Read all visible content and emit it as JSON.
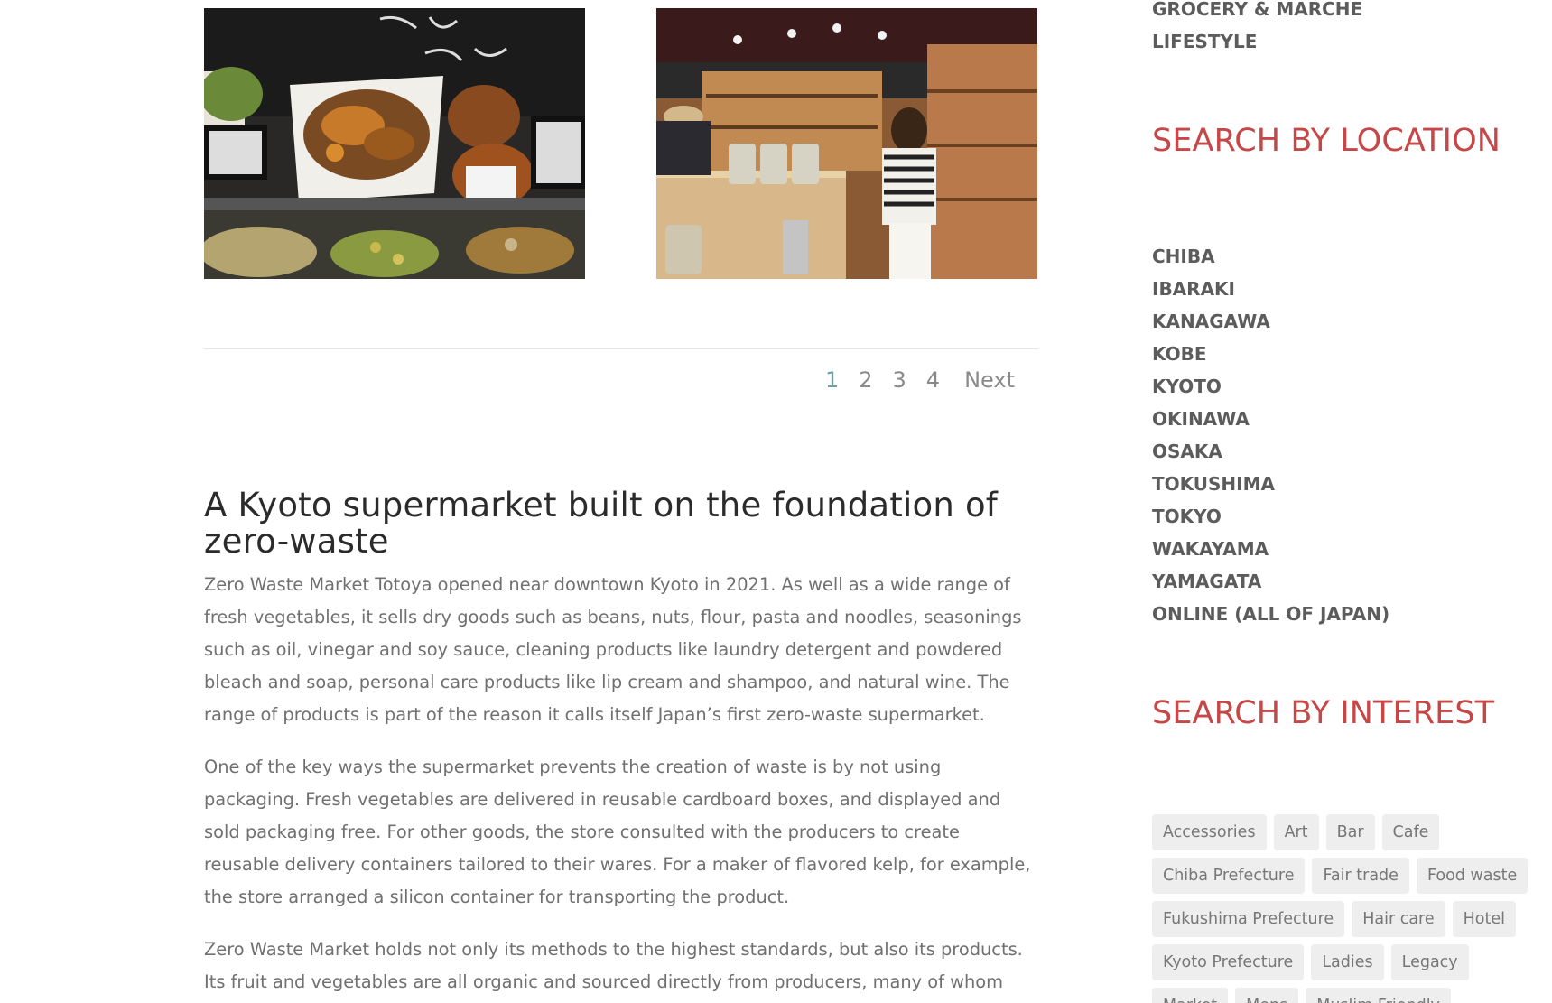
{
  "photos": [
    {
      "name": "deli-counter-photo"
    },
    {
      "name": "bulk-store-interior-photo"
    }
  ],
  "pagination": {
    "pages": [
      "1",
      "2",
      "3",
      "4"
    ],
    "current": "1",
    "next_label": "Next"
  },
  "article": {
    "title": "A Kyoto supermarket built on the foundation of zero-waste",
    "paragraphs": [
      "Zero Waste Market Totoya opened near downtown Kyoto in 2021. As well as a wide range of fresh vegetables, it sells dry goods such as beans, nuts, flour, pasta and noodles, seasonings such as oil, vinegar and soy sauce, cleaning products like laundry detergent and powdered bleach and soap, personal care products like lip cream and shampoo, and natural wine. The range of products is part of the reason it calls itself Japan’s first zero-waste supermarket.",
      "One of the key ways the supermarket prevents the creation of waste is by not using packaging. Fresh vegetables are delivered in reusable cardboard boxes, and displayed and sold packaging free. For other goods, the store consulted with the producers to create reusable delivery containers tailored to their wares. For a maker of flavored kelp, for example, the store arranged a silicon container for transporting the product.",
      "Zero Waste Market holds not only its methods to the highest standards, but also its products. Its fruit and vegetables are all organic and sourced directly from producers, many of whom"
    ]
  },
  "sidebar": {
    "categories": [
      "GROCERY & MARCHE",
      "LIFESTYLE"
    ],
    "location_title": "SEARCH BY LOCATION",
    "locations": [
      "CHIBA",
      "IBARAKI",
      "KANAGAWA",
      "KOBE",
      "KYOTO",
      "OKINAWA",
      "OSAKA",
      "TOKUSHIMA",
      "TOKYO",
      "WAKAYAMA",
      "YAMAGATA",
      "ONLINE (ALL OF JAPAN)"
    ],
    "interest_title": "SEARCH BY INTEREST",
    "tags": [
      "Accessories",
      "Art",
      "Bar",
      "Cafe",
      "Chiba Prefecture",
      "Fair trade",
      "Food waste",
      "Fukushima Prefecture",
      "Hair care",
      "Hotel",
      "Kyoto Prefecture",
      "Ladies",
      "Legacy",
      "Market",
      "Mens",
      "Muslim Friendly"
    ]
  },
  "colors": {
    "accent_heading": "#c64748",
    "pager_current": "#6f9fa3",
    "body_text": "#707070",
    "tag_bg": "#eeeeee"
  }
}
